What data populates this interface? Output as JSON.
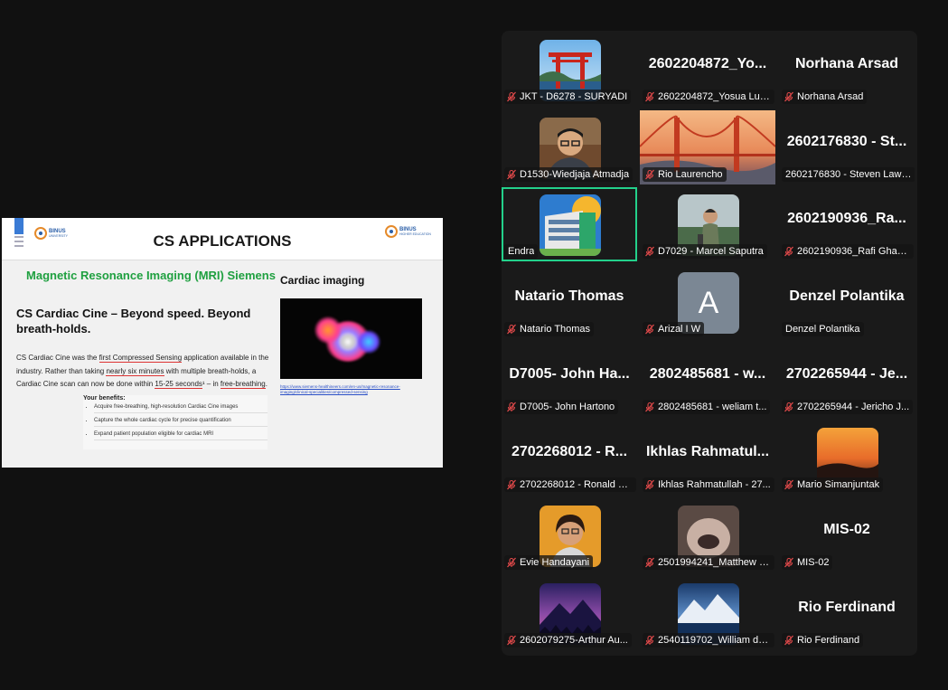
{
  "slide": {
    "title": "CS APPLICATIONS",
    "logo_left": {
      "name": "BINUS",
      "sub": "UNIVERSITY"
    },
    "logo_right": {
      "name": "BINUS",
      "sub": "HIGHER EDUCATION"
    },
    "mri_heading": "Magnetic Resonance Imaging (MRI) Siemens",
    "cine_heading": "CS Cardiac Cine – Beyond speed. Beyond breath-holds.",
    "body_parts": {
      "p1": "CS Cardiac Cine was the ",
      "p2": "first Compressed Sensing",
      "p3": " application available in the industry. Rather than taking ",
      "p4": "nearly six minutes",
      "p5": " with multiple breath-holds, a Cardiac Cine scan can now be done within ",
      "p6": "15-25 seconds",
      "p7": "¹ – in ",
      "p8": "free-breathing",
      "p9": "."
    },
    "benefits_heading": "Your benefits:",
    "benefits": [
      "Acquire free-breathing, high-resolution Cardiac Cine images",
      "Capture the whole cardiac cycle for precise quantification",
      "Expand patient population eligible for cardiac MRI"
    ],
    "cardiac_heading": "Cardiac imaging",
    "link": "https://www.siemens-healthineers.com/en-us/magnetic-resonance-imaging/clinical-specialities/compressed-sensing"
  },
  "colors": {
    "active_border": "#23d18b",
    "muted_mic": "#e0494a",
    "gallery_bg": "#1a1a1a"
  },
  "gallery": {
    "tiles": [
      {
        "big": "",
        "label": "JKT - D6278 - SURYADI",
        "avatar": "torii",
        "muted": true
      },
      {
        "big": "2602204872_Yo...",
        "label": "2602204872_Yosua Lum...",
        "muted": true
      },
      {
        "big": "Norhana Arsad",
        "label": "Norhana Arsad",
        "muted": true
      },
      {
        "big": "",
        "label": "D1530-Wiedjaja Atmadja",
        "avatar": "man-glasses",
        "muted": true
      },
      {
        "big": "",
        "label": "Rio Laurencho",
        "avatar": "golden-gate",
        "muted": true
      },
      {
        "big": "2602176830 - St...",
        "label": "2602176830 - Steven Lawr...",
        "muted": false
      },
      {
        "big": "",
        "label": "Endra",
        "avatar": "building",
        "muted": false,
        "active": true
      },
      {
        "big": "",
        "label": "D7029 - Marcel Saputra",
        "avatar": "man-outdoor",
        "muted": true
      },
      {
        "big": "2602190936_Ra...",
        "label": "2602190936_Rafi Ghazi B...",
        "muted": true
      },
      {
        "big": "Natario Thomas",
        "label": "Natario Thomas",
        "muted": true
      },
      {
        "big": "",
        "label": "Arizal I W",
        "avatar": "letter",
        "letter": "A",
        "muted": true
      },
      {
        "big": "Denzel Polantika",
        "label": "Denzel Polantika",
        "muted": false
      },
      {
        "big": "D7005- John Ha...",
        "label": "D7005- John Hartono",
        "muted": true
      },
      {
        "big": "2802485681 - w...",
        "label": "2802485681 - weliam t...",
        "muted": true
      },
      {
        "big": "2702265944 - Je...",
        "label": "2702265944 - Jericho J...",
        "muted": true
      },
      {
        "big": "2702268012 - R...",
        "label": "2702268012 - Ronald C...",
        "muted": true
      },
      {
        "big": "Ikhlas Rahmatul...",
        "label": "Ikhlas Rahmatullah - 27...",
        "muted": true
      },
      {
        "big": "",
        "label": "Mario Simanjuntak",
        "avatar": "sunset",
        "muted": true
      },
      {
        "big": "",
        "label": "Evie Handayani",
        "avatar": "woman",
        "muted": true
      },
      {
        "big": "",
        "label": "2501994241_Matthew F...",
        "avatar": "blur-face",
        "muted": true
      },
      {
        "big": "MIS-02",
        "label": "MIS-02",
        "muted": true
      },
      {
        "big": "",
        "label": "2602079275-Arthur Au...",
        "avatar": "mountain-purple",
        "muted": true
      },
      {
        "big": "",
        "label": "2540119702_William deli...",
        "avatar": "mountain-lake",
        "muted": true
      },
      {
        "big": "Rio Ferdinand",
        "label": "Rio Ferdinand",
        "muted": true
      }
    ]
  }
}
